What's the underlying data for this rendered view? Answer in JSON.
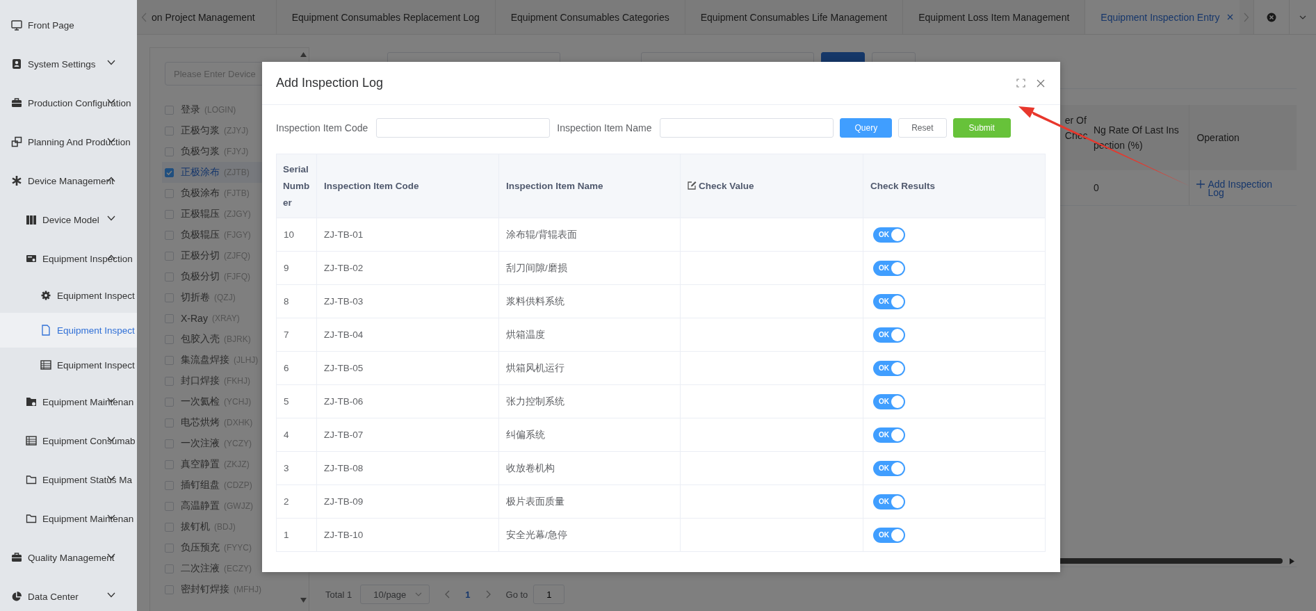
{
  "sidebar": {
    "items": [
      {
        "label": "Front Page",
        "selected": false
      },
      {
        "label": "System Settings",
        "selected": false,
        "expanded": false
      },
      {
        "label": "Production Configuration",
        "selected": false,
        "expanded": false
      },
      {
        "label": "Planning And Production",
        "selected": false,
        "expanded": false
      },
      {
        "label": "Device Management",
        "selected": false,
        "expanded": true,
        "children": [
          {
            "label": "Device Model",
            "selected": false,
            "expanded": false
          },
          {
            "label": "Equipment Inspection",
            "selected": false,
            "expanded": true,
            "children": [
              {
                "label": "Equipment Inspect",
                "selected": false
              },
              {
                "label": "Equipment Inspect",
                "selected": true
              },
              {
                "label": "Equipment Inspect",
                "selected": false
              }
            ]
          },
          {
            "label": "Equipment Maintenan",
            "selected": false,
            "expanded": false
          },
          {
            "label": "Equipment Consumab",
            "selected": false,
            "expanded": false
          },
          {
            "label": "Equipment Status Ma",
            "selected": false,
            "expanded": false
          },
          {
            "label": "Equipment Maintenan",
            "selected": false,
            "expanded": false
          }
        ]
      },
      {
        "label": "Quality Management",
        "selected": false,
        "expanded": false
      },
      {
        "label": "Data Center",
        "selected": false,
        "expanded": false
      }
    ]
  },
  "tabs": [
    {
      "label": "on Project Management",
      "selected": false
    },
    {
      "label": "Equipment Consumables Replacement Log",
      "selected": false
    },
    {
      "label": "Equipment Consumables Categories",
      "selected": false
    },
    {
      "label": "Equipment Consumables Life Management",
      "selected": false
    },
    {
      "label": "Equipment Loss Item Management",
      "selected": false
    },
    {
      "label": "Equipment Inspection Entry",
      "selected": true
    }
  ],
  "device_tree": {
    "search": {
      "placeholder": "Please Enter Device"
    },
    "items": [
      {
        "label": "登录",
        "code": "(LOGIN)",
        "checked": false,
        "selected": false
      },
      {
        "label": "正极匀浆",
        "code": "(ZJYJ)",
        "checked": false,
        "selected": false
      },
      {
        "label": "负极匀浆",
        "code": "(FJYJ)",
        "checked": false,
        "selected": false
      },
      {
        "label": "正极涂布",
        "code": "(ZJTB)",
        "checked": true,
        "selected": true
      },
      {
        "label": "负极涂布",
        "code": "(FJTB)",
        "checked": false,
        "selected": false
      },
      {
        "label": "正极辊压",
        "code": "(ZJGY)",
        "checked": false,
        "selected": false
      },
      {
        "label": "负极辊压",
        "code": "(FJGY)",
        "checked": false,
        "selected": false
      },
      {
        "label": "正极分切",
        "code": "(ZJFQ)",
        "checked": false,
        "selected": false
      },
      {
        "label": "负极分切",
        "code": "(FJFQ)",
        "checked": false,
        "selected": false
      },
      {
        "label": "切折卷",
        "code": "(QZJ)",
        "checked": false,
        "selected": false
      },
      {
        "label": "X-Ray",
        "code": "(XRAY)",
        "checked": false,
        "selected": false
      },
      {
        "label": "包胶入壳",
        "code": "(BJRK)",
        "checked": false,
        "selected": false
      },
      {
        "label": "集流盘焊接",
        "code": "(JLHJ)",
        "checked": false,
        "selected": false
      },
      {
        "label": "封口焊接",
        "code": "(FKHJ)",
        "checked": false,
        "selected": false
      },
      {
        "label": "一次氦检",
        "code": "(YCHJ)",
        "checked": false,
        "selected": false
      },
      {
        "label": "电芯烘烤",
        "code": "(DXHK)",
        "checked": false,
        "selected": false
      },
      {
        "label": "一次注液",
        "code": "(YCZY)",
        "checked": false,
        "selected": false
      },
      {
        "label": "真空静置",
        "code": "(ZKJZ)",
        "checked": false,
        "selected": false
      },
      {
        "label": "插钉组盘",
        "code": "(CDZP)",
        "checked": false,
        "selected": false
      },
      {
        "label": "高温静置",
        "code": "(GWJZ)",
        "checked": false,
        "selected": false
      },
      {
        "label": "拔钉机",
        "code": "(BDJ)",
        "checked": false,
        "selected": false
      },
      {
        "label": "负压预充",
        "code": "(FYYC)",
        "checked": false,
        "selected": false
      },
      {
        "label": "二次注液",
        "code": "(ECZY)",
        "checked": false,
        "selected": false
      },
      {
        "label": "密封钉焊接",
        "code": "(MFHJ)",
        "checked": false,
        "selected": false
      }
    ]
  },
  "table": {
    "columns": [
      {
        "label": "er Of Chec"
      },
      {
        "label": "Ng Rate Of Last Inspection (%)"
      },
      {
        "label": "Operation"
      }
    ],
    "rows": [
      {
        "ng_rate": "0",
        "action": "Add Inspection Log"
      }
    ]
  },
  "pagination": {
    "total": "Total 1",
    "page_size": "10/page",
    "pages": [
      {
        "label": "1",
        "selected": true
      }
    ],
    "goto_label": "Go to",
    "goto_value": "1"
  },
  "dialog": {
    "title": "Add Inspection Log",
    "filters": [
      {
        "label": "Inspection Item Code"
      },
      {
        "label": "Inspection Item Name"
      }
    ],
    "buttons": [
      {
        "label": "Query",
        "kind": "primary"
      },
      {
        "label": "Reset",
        "kind": "default"
      },
      {
        "label": "Submit",
        "kind": "success"
      }
    ],
    "table": {
      "columns": [
        {
          "label": "Serial Number",
          "editable": false
        },
        {
          "label": "Inspection Item Code",
          "editable": false
        },
        {
          "label": "Inspection Item Name",
          "editable": false
        },
        {
          "label": "Check Value",
          "editable": true
        },
        {
          "label": "Check Results",
          "editable": false
        }
      ],
      "rows": [
        {
          "serial": "10",
          "code": "ZJ-TB-01",
          "name": "涂布辊/背辊表面",
          "result": {
            "label": "OK",
            "on": true
          }
        },
        {
          "serial": "9",
          "code": "ZJ-TB-02",
          "name": "刮刀间隙/磨损",
          "result": {
            "label": "OK",
            "on": true
          }
        },
        {
          "serial": "8",
          "code": "ZJ-TB-03",
          "name": "浆料供料系统",
          "result": {
            "label": "OK",
            "on": true
          }
        },
        {
          "serial": "7",
          "code": "ZJ-TB-04",
          "name": "烘箱温度",
          "result": {
            "label": "OK",
            "on": true
          }
        },
        {
          "serial": "6",
          "code": "ZJ-TB-05",
          "name": "烘箱风机运行",
          "result": {
            "label": "OK",
            "on": true
          }
        },
        {
          "serial": "5",
          "code": "ZJ-TB-06",
          "name": "张力控制系统",
          "result": {
            "label": "OK",
            "on": true
          }
        },
        {
          "serial": "4",
          "code": "ZJ-TB-07",
          "name": "纠偏系统",
          "result": {
            "label": "OK",
            "on": true
          }
        },
        {
          "serial": "3",
          "code": "ZJ-TB-08",
          "name": "收放卷机构",
          "result": {
            "label": "OK",
            "on": true
          }
        },
        {
          "serial": "2",
          "code": "ZJ-TB-09",
          "name": "极片表面质量",
          "result": {
            "label": "OK",
            "on": true
          }
        },
        {
          "serial": "1",
          "code": "ZJ-TB-10",
          "name": "安全光幕/急停",
          "result": {
            "label": "OK",
            "on": true
          }
        }
      ]
    }
  }
}
